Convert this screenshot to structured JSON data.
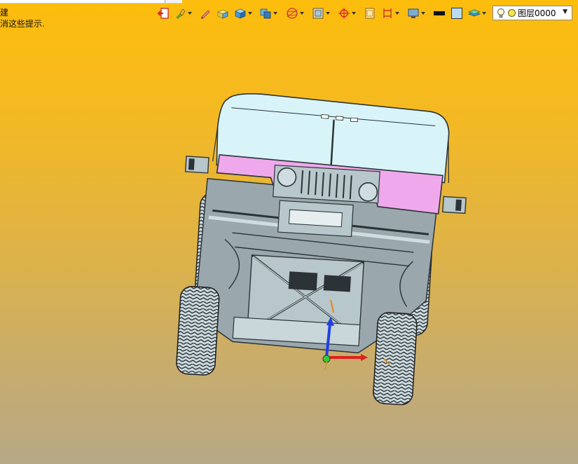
{
  "hints": {
    "line1": "建",
    "line2": "消这些提示."
  },
  "toolbar": {
    "icons": [
      "exit-sketch-icon",
      "spray-icon",
      "pen-icon",
      "box-icon",
      "cube-icon",
      "view-cube-icon",
      "sphere-wire-icon",
      "frame-icon",
      "target-icon",
      "sheet-icon",
      "bracket-icon",
      "display-icon",
      "line-color-icon",
      "fill-color-icon",
      "layers-icon"
    ]
  },
  "layer": {
    "name": "图层0000",
    "color": "#f3e54b"
  },
  "colors": {
    "background_top": "#fdbd0c",
    "background_bottom": "#b7a886",
    "vehicle_pink": "#f0a8ec",
    "vehicle_gray": "#9aa8ad",
    "windshield": "#d8f4f8"
  }
}
